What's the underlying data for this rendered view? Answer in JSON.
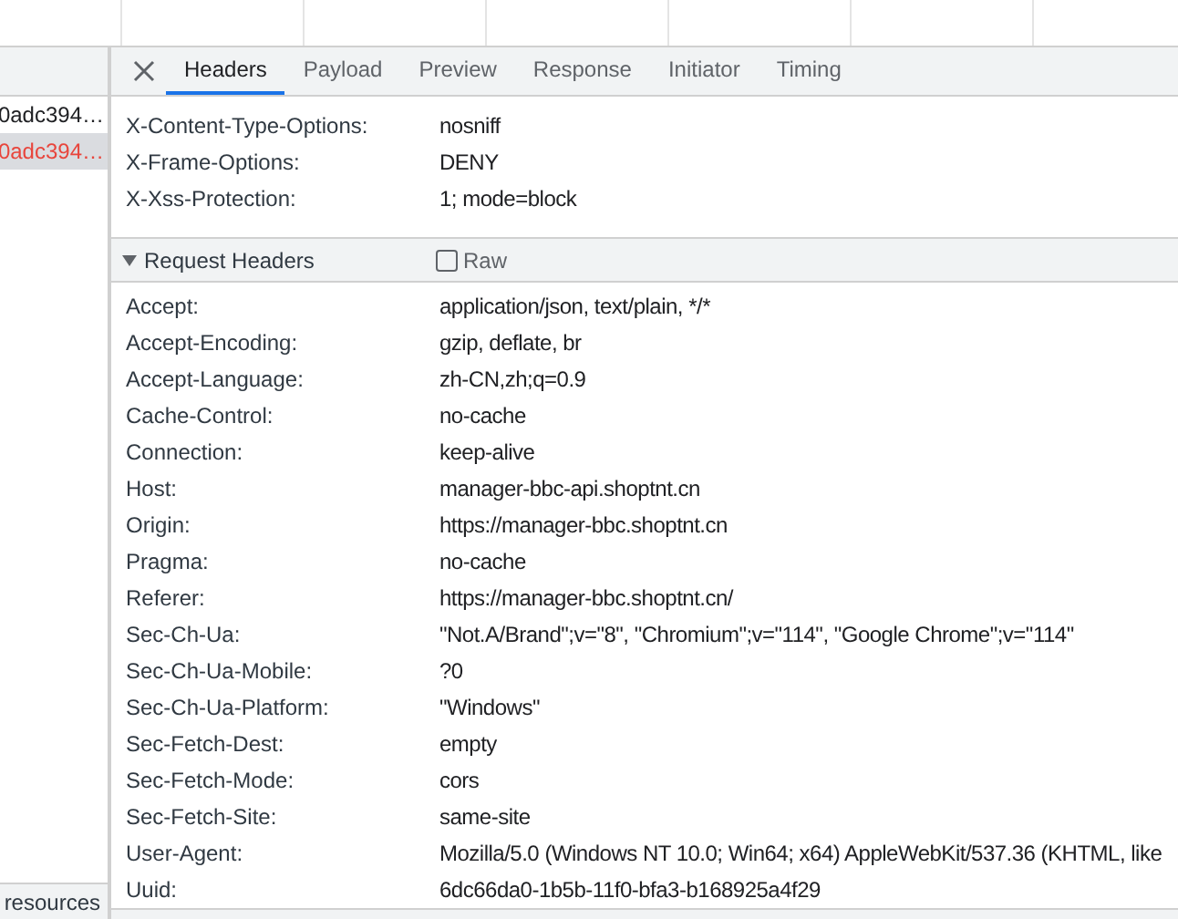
{
  "request_list": {
    "items": [
      {
        "name": "0adc394…",
        "selected": false,
        "failed": false
      },
      {
        "name": "0adc394…",
        "selected": true,
        "failed": true
      }
    ],
    "footer": "resources"
  },
  "tabs": [
    {
      "label": "Headers",
      "selected": true
    },
    {
      "label": "Payload",
      "selected": false
    },
    {
      "label": "Preview",
      "selected": false
    },
    {
      "label": "Response",
      "selected": false
    },
    {
      "label": "Initiator",
      "selected": false
    },
    {
      "label": "Timing",
      "selected": false
    }
  ],
  "response_headers": [
    {
      "name": "X-Content-Type-Options:",
      "value": "nosniff"
    },
    {
      "name": "X-Frame-Options:",
      "value": "DENY"
    },
    {
      "name": "X-Xss-Protection:",
      "value": "1; mode=block"
    }
  ],
  "request_headers": {
    "title": "Request Headers",
    "expanded": true,
    "raw": {
      "label": "Raw",
      "checked": false
    },
    "rows": [
      {
        "name": "Accept:",
        "value": "application/json, text/plain, */*"
      },
      {
        "name": "Accept-Encoding:",
        "value": "gzip, deflate, br"
      },
      {
        "name": "Accept-Language:",
        "value": "zh-CN,zh;q=0.9"
      },
      {
        "name": "Cache-Control:",
        "value": "no-cache"
      },
      {
        "name": "Connection:",
        "value": "keep-alive"
      },
      {
        "name": "Host:",
        "value": "manager-bbc-api.shoptnt.cn"
      },
      {
        "name": "Origin:",
        "value": "https://manager-bbc.shoptnt.cn"
      },
      {
        "name": "Pragma:",
        "value": "no-cache"
      },
      {
        "name": "Referer:",
        "value": "https://manager-bbc.shoptnt.cn/"
      },
      {
        "name": "Sec-Ch-Ua:",
        "value": "\"Not.A/Brand\";v=\"8\", \"Chromium\";v=\"114\", \"Google Chrome\";v=\"114\""
      },
      {
        "name": "Sec-Ch-Ua-Mobile:",
        "value": "?0"
      },
      {
        "name": "Sec-Ch-Ua-Platform:",
        "value": "\"Windows\""
      },
      {
        "name": "Sec-Fetch-Dest:",
        "value": "empty"
      },
      {
        "name": "Sec-Fetch-Mode:",
        "value": "cors"
      },
      {
        "name": "Sec-Fetch-Site:",
        "value": "same-site"
      },
      {
        "name": "User-Agent:",
        "value": "Mozilla/5.0 (Windows NT 10.0; Win64; x64) AppleWebKit/537.36 (KHTML, like"
      },
      {
        "name": "Uuid:",
        "value": "6dc66da0-1b5b-11f0-bfa3-b168925a4f29"
      }
    ]
  }
}
